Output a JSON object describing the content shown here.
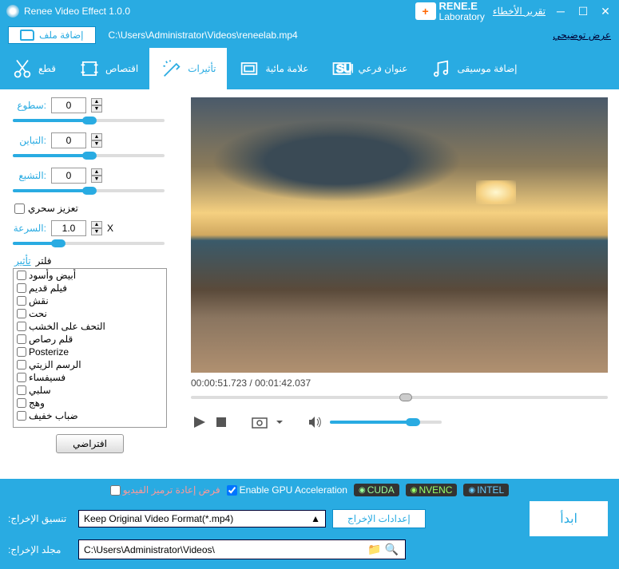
{
  "title": "Renee Video Effect 1.0.0",
  "bugreport": "تقرير الأخطاء",
  "brand": {
    "top": "RENE.E",
    "sub": "Laboratory"
  },
  "addfile": "إضافة ملف",
  "filepath": "C:\\Users\\Administrator\\Videos\\reneelab.mp4",
  "demo": "عرض توضيحي",
  "tabs": [
    "قطع",
    "اقتصاص",
    "تأثيرات",
    "علامة مائية",
    "عنوان فرعي",
    "إضافة موسيقى"
  ],
  "brightness": {
    "label": "سطوع:",
    "value": "0"
  },
  "contrast": {
    "label": "التباين:",
    "value": "0"
  },
  "saturation": {
    "label": "التشبع:",
    "value": "0"
  },
  "magic": "تعزيز سحري",
  "speed": {
    "label": "السرعة:",
    "value": "1.0",
    "suffix": "X"
  },
  "filter_hdr": {
    "a": "تأثير",
    "b": "فلتر"
  },
  "filters": [
    "أبيض وأسود",
    "فيلم قديم",
    "نقش",
    "نحت",
    "التحف على الخشب",
    "قلم رصاص",
    "Posterize",
    "الرسم الزيتي",
    "فسيفساء",
    "سلبي",
    "وهج",
    "ضباب خفيف"
  ],
  "default_btn": "افتراضي",
  "time": "00:00:51.723 / 00:01:42.037",
  "opt_reencode": "فرض إعادة ترميز الفيديو",
  "opt_gpu": "Enable GPU Acceleration",
  "badges": [
    "CUDA",
    "NVENC",
    "INTEL"
  ],
  "fmt_label": ":تنسيق الإخراج",
  "fmt_value": "Keep Original Video Format(*.mp4)",
  "out_settings": "إعدادات الإخراج",
  "start": "ابدأ",
  "dir_label": ":مجلد الإخراج",
  "dir_value": "C:\\Users\\Administrator\\Videos\\"
}
